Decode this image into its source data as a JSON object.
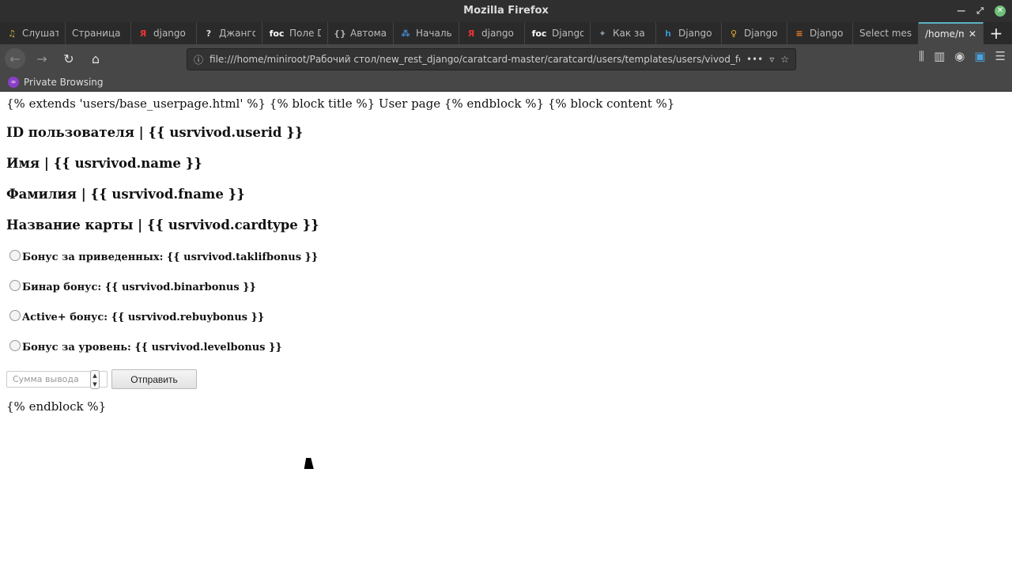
{
  "window": {
    "title": "Mozilla Firefox"
  },
  "tabs": [
    {
      "label": "Слушат",
      "icon": "music-icon",
      "color": "#c8b040"
    },
    {
      "label": "Страница м",
      "icon": "",
      "color": ""
    },
    {
      "label": "django",
      "icon": "yandex-icon",
      "color": "#e33"
    },
    {
      "label": "Джанго",
      "icon": "question-icon",
      "color": "#ddd"
    },
    {
      "label": "Поле Dj",
      "icon": "foc-icon",
      "color": "#fff"
    },
    {
      "label": "Автома",
      "icon": "braces-icon",
      "color": "#aaa"
    },
    {
      "label": "Началь",
      "icon": "network-icon",
      "color": "#4a90d9"
    },
    {
      "label": "django",
      "icon": "yandex-icon",
      "color": "#e33"
    },
    {
      "label": "Django",
      "icon": "foc-icon",
      "color": "#fff"
    },
    {
      "label": "Как за",
      "icon": "sparkle-icon",
      "color": "#89a"
    },
    {
      "label": "Django",
      "icon": "h-icon",
      "color": "#3a8fc4"
    },
    {
      "label": "Django",
      "icon": "bulb-icon",
      "color": "#e8b030"
    },
    {
      "label": "Django",
      "icon": "stackoverflow-icon",
      "color": "#f48024"
    },
    {
      "label": "Select mess",
      "icon": "",
      "color": ""
    },
    {
      "label": "/home/m",
      "icon": "",
      "color": "",
      "active": true
    }
  ],
  "nav": {
    "url": "file:///home/miniroot/Рабочий стол/new_rest_django/caratcard-master/caratcard/users/templates/users/vivod_form.ht",
    "private_label": "Private Browsing"
  },
  "page": {
    "line1": "{% extends 'users/base_userpage.html' %} {% block title %} User page {% endblock %} {% block content %}",
    "headings": [
      "ID пользователя | {{ usrvivod.userid }}",
      "Имя | {{ usrvivod.name }}",
      "Фамилия | {{ usrvivod.fname }}",
      "Название карты | {{ usrvivod.cardtype }}"
    ],
    "radios": [
      "Бонус за приведенных: {{ usrvivod.taklifbonus }}",
      "Бинар бонус: {{ usrvivod.binarbonus }}",
      "Active+ бонус: {{ usrvivod.rebuybonus }}",
      "Бонус за уровень: {{ usrvivod.levelbonus }}"
    ],
    "amount_placeholder": "Сумма вывода",
    "submit_label": "Отправить",
    "end": "{% endblock %}"
  }
}
